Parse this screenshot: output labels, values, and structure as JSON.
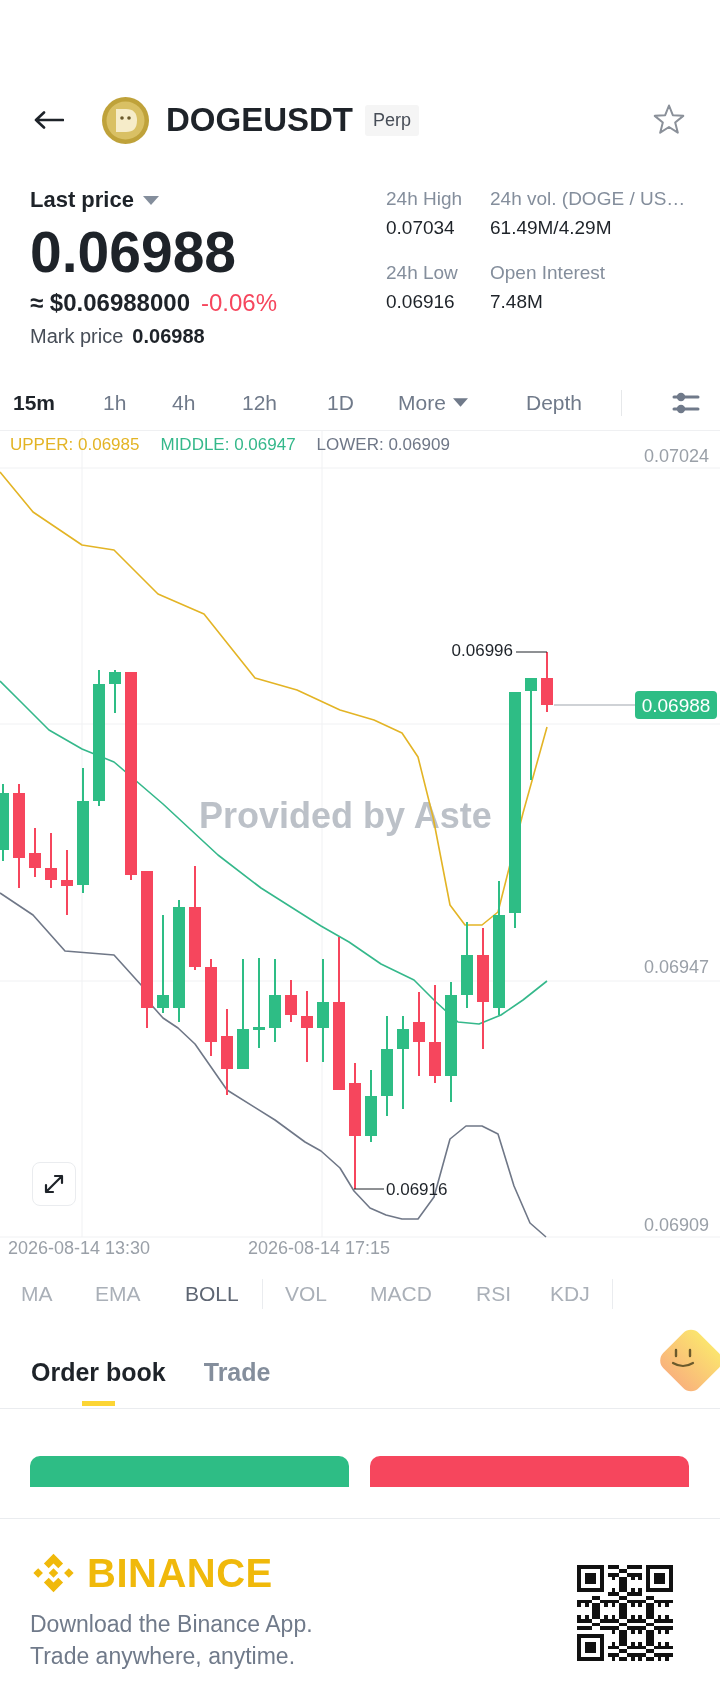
{
  "header": {
    "symbol": "DOGEUSDT",
    "tag": "Perp"
  },
  "price": {
    "label": "Last price",
    "last": "0.06988",
    "usd": "≈ $0.06988000",
    "change": "-0.06%",
    "mark_label": "Mark price",
    "mark": "0.06988"
  },
  "stats": [
    {
      "label": "24h High",
      "value": "0.07034"
    },
    {
      "label": "24h vol. (DOGE / US…",
      "value": "61.49M/4.29M"
    },
    {
      "label": "24h Low",
      "value": "0.06916"
    },
    {
      "label": "Open Interest",
      "value": "7.48M"
    }
  ],
  "timeframes": [
    {
      "label": "15m",
      "selected": true
    },
    {
      "label": "1h",
      "selected": false
    },
    {
      "label": "4h",
      "selected": false
    },
    {
      "label": "12h",
      "selected": false
    },
    {
      "label": "1D",
      "selected": false
    }
  ],
  "more_menu": "More",
  "depth_tab": {
    "label": "Depth",
    "selected": false
  },
  "chart": {
    "legend": [
      {
        "label": "UPPER: 0.06985",
        "color": "#e3b425"
      },
      {
        "label": "MIDDLE: 0.06947",
        "color": "#35b88b"
      },
      {
        "label": "LOWER: 0.06909",
        "color": "#6f7787"
      }
    ],
    "price_labels": [
      "0.07024",
      "0.06947",
      "0.06909"
    ],
    "time_labels": [
      "2026-08-14 13:30",
      "2026-08-14 17:15"
    ],
    "high_label": "0.06996",
    "low_label": "0.06916",
    "last_price_tag": "0.06988",
    "provider": "Provided by Aste"
  },
  "indicator_groups": [
    {
      "items": [
        {
          "label": "MA",
          "selected": false
        },
        {
          "label": "EMA",
          "selected": false
        },
        {
          "label": "BOLL",
          "selected": true
        }
      ]
    },
    {
      "items": [
        {
          "label": "VOL",
          "selected": false
        },
        {
          "label": "MACD",
          "selected": false
        },
        {
          "label": "RSI",
          "selected": false
        },
        {
          "label": "KDJ",
          "selected": false
        }
      ]
    }
  ],
  "book_tabs": [
    {
      "label": "Order book",
      "selected": true
    },
    {
      "label": "Trade",
      "selected": false
    }
  ],
  "trade_buttons": [
    {
      "kind": "buy"
    },
    {
      "kind": "sell"
    }
  ],
  "footer": {
    "brand": "BINANCE",
    "lines": [
      "Download the Binance App.",
      "Trade anywhere, anytime."
    ]
  }
}
